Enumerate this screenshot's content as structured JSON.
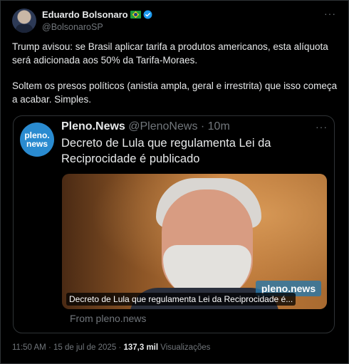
{
  "tweet": {
    "author_name": "Eduardo Bolsonaro",
    "author_handle": "@BolsonaroSP",
    "paragraphs": [
      "Trump avisou: se Brasil aplicar tarifa a produtos americanos, esta alíquota será adicionada aos 50% da Tarifa-Moraes.",
      "Soltem os presos políticos (anistia ampla, geral e irrestrita) que isso começa a acabar. Simples."
    ],
    "more": "···"
  },
  "quote": {
    "logo_line1": "pleno.",
    "logo_line2": "news",
    "name": "Pleno.News",
    "handle": "@PlenoNews",
    "sep": " · ",
    "time": "10m",
    "text": "Decreto de Lula que regulamenta Lei da Reciprocidade é publicado",
    "more": "···",
    "image_caption": "Decreto de Lula que regulamenta Lei da Reciprocidade é...",
    "image_watermark": "pleno.news",
    "link_source": "From pleno.news"
  },
  "meta": {
    "time": "11:50 AM",
    "date": "15 de jul de 2025",
    "sep": " · ",
    "views_count": "137,3 mil",
    "views_label": "Visualizações"
  },
  "colors": {
    "background": "#000000",
    "text": "#e7e9ea",
    "muted": "#71767b",
    "verified": "#1d9bf0",
    "border": "#2f3336"
  }
}
